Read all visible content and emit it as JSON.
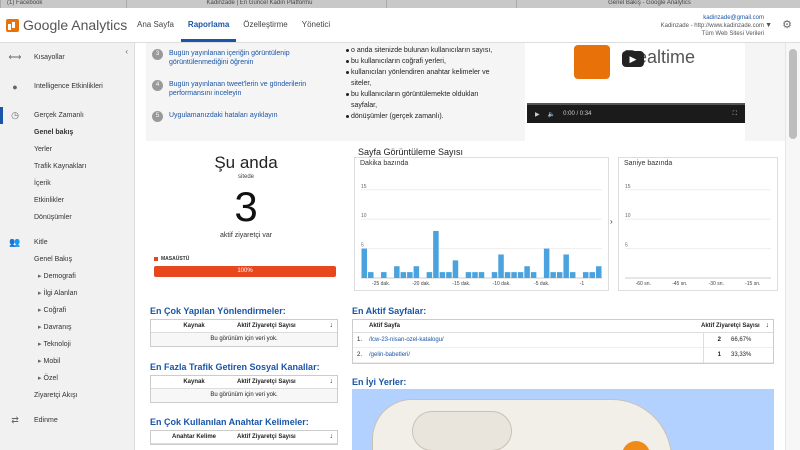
{
  "browser_tabs": [
    "(1) Facebook",
    "Kadinzade | En Güncel Kadın Platformu",
    "",
    "Genel Bakış - Google Analytics"
  ],
  "app": {
    "logo_text": "Google Analytics",
    "nav": [
      "Ana Sayfa",
      "Raporlama",
      "Özelleştirme",
      "Yönetici"
    ],
    "active_nav": "Raporlama",
    "account_email": "kadinzade@gmail.com",
    "account_site": "Kadinzade - http://www.kadinzade.com",
    "account_view": "Tüm Web Sitesi Verileri"
  },
  "sidebar": {
    "items": [
      {
        "icon": "shortcut-icon",
        "label": "Kısayollar"
      },
      {
        "icon": "intelligence-icon",
        "label": "Intelligence Etkinlikleri"
      },
      {
        "icon": "clock-icon",
        "label": "Gerçek Zamanlı"
      }
    ],
    "realtime_sub": [
      "Genel bakış",
      "Yerler",
      "Trafik Kaynakları",
      "İçerik",
      "Etkinlikler",
      "Dönüşümler"
    ],
    "audience": {
      "icon": "people-icon",
      "label": "Kitle"
    },
    "audience_sub": [
      "Genel Bakış",
      "Demografi",
      "İlgi Alanları",
      "Coğrafi",
      "Davranış",
      "Teknoloji",
      "Mobil",
      "Özel",
      "Ziyaretçi Akışı"
    ],
    "acquisition": {
      "icon": "arrows-icon",
      "label": "Edinme"
    }
  },
  "help": [
    {
      "num": "3",
      "text": "Bugün yayınlanan içeriğin görüntülenip görüntülenmediğini öğrenin"
    },
    {
      "num": "4",
      "text": "Bugün yayınlanan tweet'lerin ve gönderilerin performansını inceleyin"
    },
    {
      "num": "5",
      "text": "Uygulamanızdaki hataları ayıklayın"
    }
  ],
  "intro_list": [
    [
      "o anda sitenizde bulunan kullanıcıların sayısı,"
    ],
    [
      "bu kullanıcıların coğrafi yerleri,"
    ],
    [
      "kullanıcıları yönlendiren anahtar kelimeler ve",
      "siteler,"
    ],
    [
      "bu kullanıcıların görüntülemekte oldukları",
      "sayfalar,"
    ],
    [
      "dönüşümler (gerçek zamanlı)."
    ]
  ],
  "video": {
    "title": "Realtime",
    "time": "0:00 / 0:34"
  },
  "realtime": {
    "title": "Şu anda",
    "subtitle": "sitede",
    "count": "3",
    "desc": "aktif ziyaretçi var",
    "device": "MASAÜSTÜ",
    "percent": "100%",
    "fraction": 1.0
  },
  "pageviews": {
    "title": "Sayfa Görüntüleme Sayısı",
    "minute_label": "Dakika bazında",
    "second_label": "Saniye bazında"
  },
  "chart_data": [
    {
      "type": "bar",
      "title": "Dakika bazında",
      "x_ticks": [
        "-25 dak.",
        "-20 dak.",
        "-15 dak.",
        "-10 dak.",
        "-5 dak.",
        "-1"
      ],
      "y_ticks": [
        "15",
        "10",
        "5"
      ],
      "ylim": [
        0,
        17
      ],
      "values": [
        5,
        1,
        0,
        1,
        0,
        2,
        1,
        1,
        2,
        0,
        1,
        8,
        1,
        1,
        3,
        0,
        1,
        1,
        1,
        0,
        1,
        4,
        1,
        1,
        1,
        2,
        1,
        0,
        5,
        1,
        1,
        4,
        1,
        0,
        1,
        1,
        2
      ]
    },
    {
      "type": "bar",
      "title": "Saniye bazında",
      "x_ticks": [
        "-60 sn.",
        "-45 sn.",
        "-30 sn.",
        "-15 sn."
      ],
      "y_ticks": [
        "15",
        "10",
        "5"
      ],
      "ylim": [
        0,
        17
      ],
      "values": []
    }
  ],
  "referrals": {
    "title": "En Çok Yapılan Yönlendirmeler:",
    "col1": "Kaynak",
    "col2": "Aktif Ziyaretçi Sayısı",
    "empty": "Bu görünüm için veri yok."
  },
  "social": {
    "title": "En Fazla Trafik Getiren Sosyal Kanallar:",
    "col1": "Kaynak",
    "col2": "Aktif Ziyaretçi Sayısı",
    "empty": "Bu görünüm için veri yok."
  },
  "keywords": {
    "title": "En Çok Kullanılan Anahtar Kelimeler:",
    "col1": "Anahtar Kelime",
    "col2": "Aktif Ziyaretçi Sayısı"
  },
  "active_pages": {
    "title": "En Aktif Sayfalar:",
    "col1": "Aktif Sayfa",
    "col2": "Aktif Ziyaretçi Sayısı",
    "rows": [
      {
        "idx": "1.",
        "page": "/lcw-23-nisan-ozel-katalogu/",
        "count": "2",
        "pct": "66,67%"
      },
      {
        "idx": "2.",
        "page": "/gelin-babetleri/",
        "count": "1",
        "pct": "33,33%"
      }
    ]
  },
  "locations": {
    "title": "En İyi Yerler:"
  },
  "colors": {
    "accent": "#1a55a8",
    "bar": "#4aa3df",
    "device_bar": "#e8471d",
    "ga_orange": "#e8710a"
  }
}
